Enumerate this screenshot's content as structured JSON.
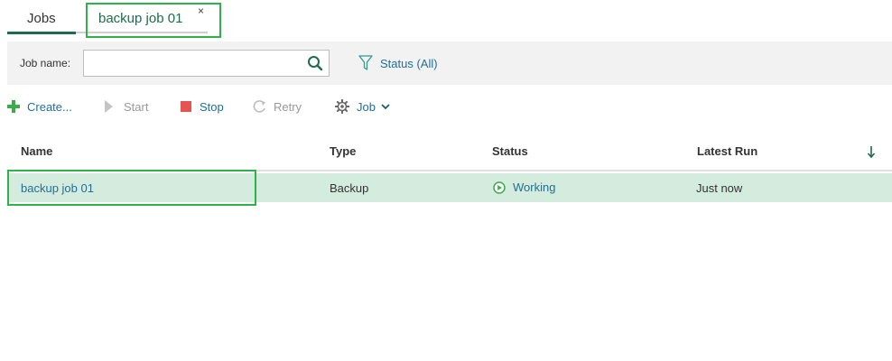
{
  "tabs": {
    "jobs_label": "Jobs",
    "active_label": "backup job 01",
    "close_glyph": "×"
  },
  "filter": {
    "job_name_label": "Job name:",
    "search_value": "",
    "search_placeholder": "",
    "status_label": "Status (All)"
  },
  "toolbar": {
    "create_label": "Create...",
    "start_label": "Start",
    "stop_label": "Stop",
    "retry_label": "Retry",
    "job_label": "Job"
  },
  "table": {
    "columns": [
      "Name",
      "Type",
      "Status",
      "Latest Run"
    ],
    "rows": [
      {
        "name": "backup job 01",
        "type": "Backup",
        "status": "Working",
        "latest_run": "Just now"
      }
    ]
  },
  "colors": {
    "accent_green": "#2db34a",
    "link_blue": "#1f6f99",
    "selected_row": "#d3ecde",
    "tab_underline": "#1e6b4f",
    "stop_red": "#e55353"
  }
}
